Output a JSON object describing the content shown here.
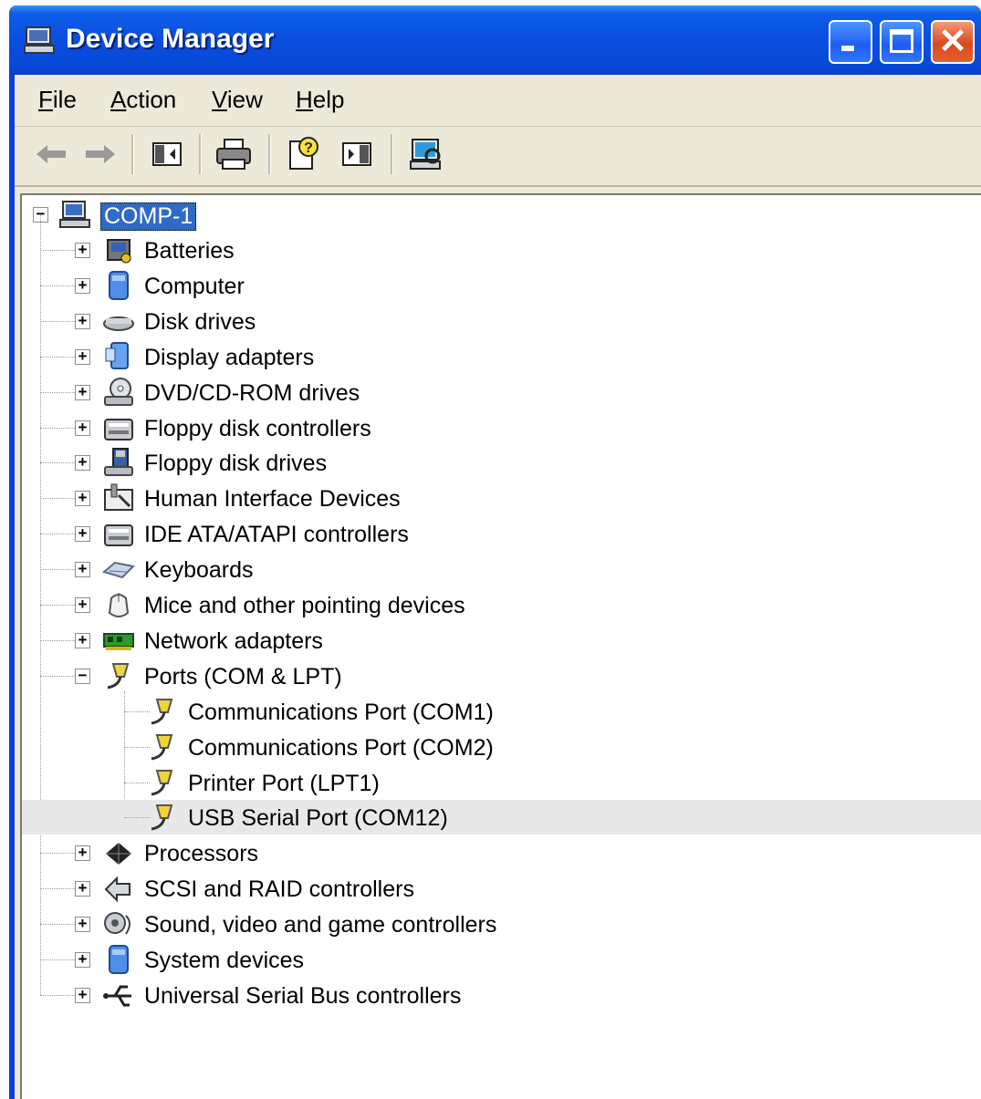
{
  "window": {
    "title": "Device Manager"
  },
  "menu": [
    {
      "label": "File",
      "accel": "F",
      "rest": "ile"
    },
    {
      "label": "Action",
      "accel": "A",
      "rest": "ction"
    },
    {
      "label": "View",
      "accel": "V",
      "rest": "iew"
    },
    {
      "label": "Help",
      "accel": "H",
      "rest": "elp"
    }
  ],
  "toolbar": [
    "back-icon",
    "forward-icon",
    "show-hide-tree-icon",
    "print-icon",
    "help-icon",
    "properties-panel-icon",
    "scan-hardware-icon"
  ],
  "tree": {
    "root": "COMP-1",
    "categories": [
      {
        "label": "Batteries",
        "icon": "battery-icon"
      },
      {
        "label": "Computer",
        "icon": "computer-icon"
      },
      {
        "label": "Disk drives",
        "icon": "disk-drive-icon"
      },
      {
        "label": "Display adapters",
        "icon": "display-adapter-icon"
      },
      {
        "label": "DVD/CD-ROM drives",
        "icon": "cdrom-icon"
      },
      {
        "label": "Floppy disk controllers",
        "icon": "controller-icon"
      },
      {
        "label": "Floppy disk drives",
        "icon": "floppy-icon"
      },
      {
        "label": "Human Interface Devices",
        "icon": "hid-icon"
      },
      {
        "label": "IDE ATA/ATAPI controllers",
        "icon": "controller-icon"
      },
      {
        "label": "Keyboards",
        "icon": "keyboard-icon"
      },
      {
        "label": "Mice and other pointing devices",
        "icon": "mouse-icon"
      },
      {
        "label": "Network adapters",
        "icon": "network-adapter-icon"
      },
      {
        "label": "Ports (COM & LPT)",
        "icon": "port-icon",
        "expanded": true,
        "children": [
          "Communications Port (COM1)",
          "Communications Port (COM2)",
          "Printer Port (LPT1)",
          "USB Serial Port (COM12)"
        ]
      },
      {
        "label": "Processors",
        "icon": "processor-icon"
      },
      {
        "label": "SCSI and RAID controllers",
        "icon": "scsi-icon"
      },
      {
        "label": "Sound, video and game controllers",
        "icon": "sound-icon"
      },
      {
        "label": "System devices",
        "icon": "system-devices-icon"
      },
      {
        "label": "Universal Serial Bus controllers",
        "icon": "usb-icon"
      }
    ],
    "highlighted_child": "USB Serial Port (COM12)"
  }
}
